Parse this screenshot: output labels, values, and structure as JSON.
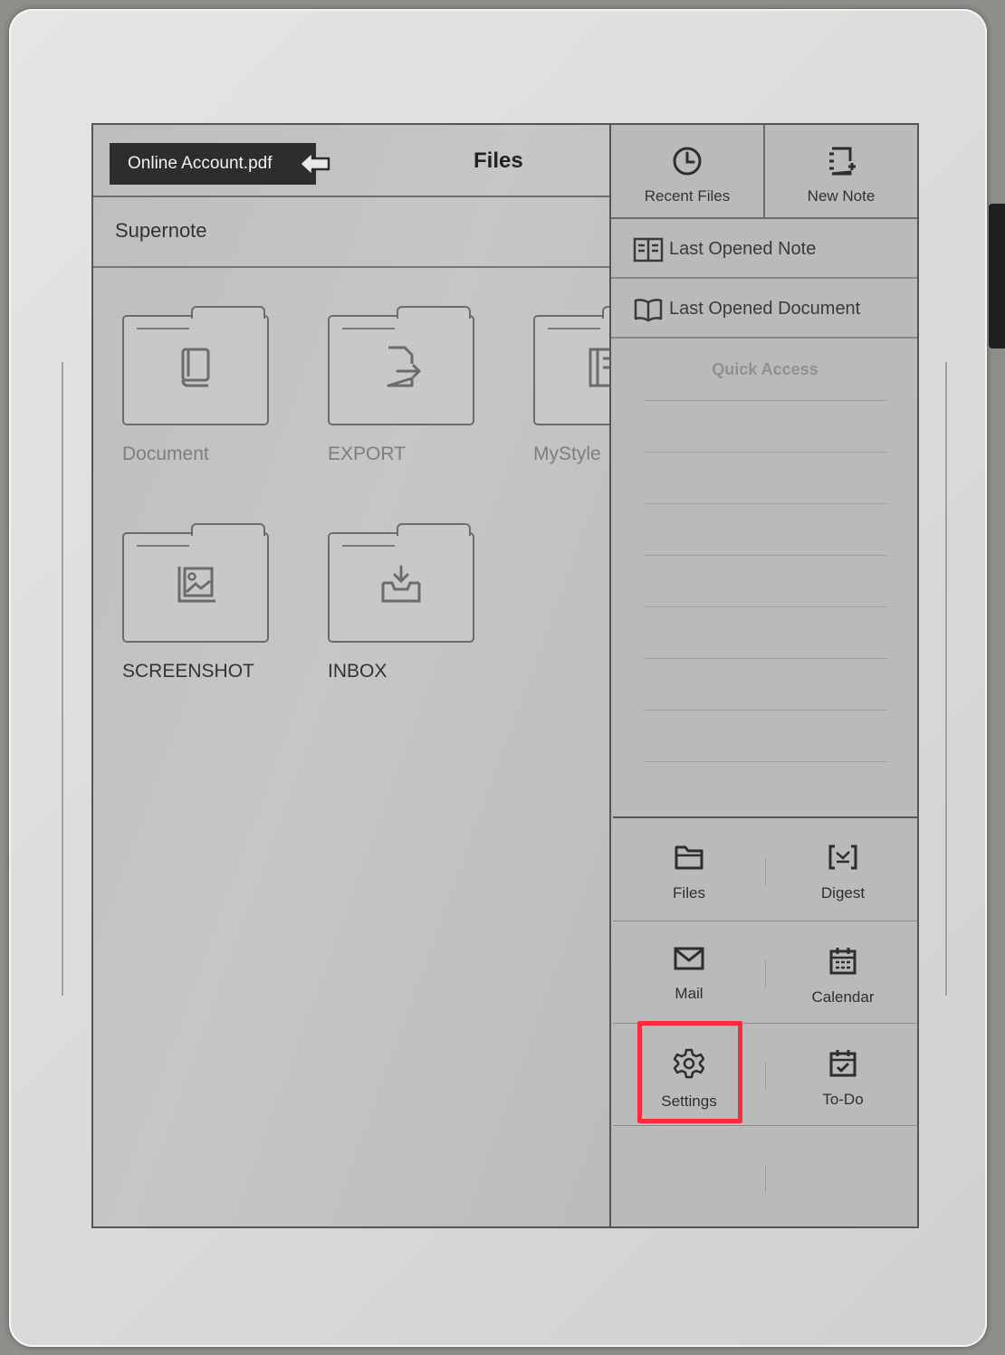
{
  "topbar": {
    "document_tag": "Online Account.pdf",
    "title": "Files"
  },
  "path": {
    "current": "Supernote"
  },
  "folders": [
    {
      "label": "Document",
      "icon": "book-icon"
    },
    {
      "label": "EXPORT",
      "icon": "export-icon"
    },
    {
      "label": "MyStyle",
      "icon": "template-icon"
    },
    {
      "label": "SCREENSHOT",
      "icon": "image-icon"
    },
    {
      "label": "INBOX",
      "icon": "inbox-icon"
    }
  ],
  "side_panel": {
    "recent_files": "Recent Files",
    "new_note": "New Note",
    "last_opened_note": "Last Opened Note",
    "last_opened_document": "Last Opened Document",
    "quick_access": "Quick Access"
  },
  "apps": [
    {
      "label": "Files",
      "icon": "folder-icon"
    },
    {
      "label": "Digest",
      "icon": "digest-icon"
    },
    {
      "label": "Mail",
      "icon": "mail-icon"
    },
    {
      "label": "Calendar",
      "icon": "calendar-icon"
    },
    {
      "label": "Settings",
      "icon": "gear-icon"
    },
    {
      "label": "To-Do",
      "icon": "todo-icon"
    }
  ],
  "highlight": {
    "target": "Settings",
    "color": "#ff2a3b"
  }
}
